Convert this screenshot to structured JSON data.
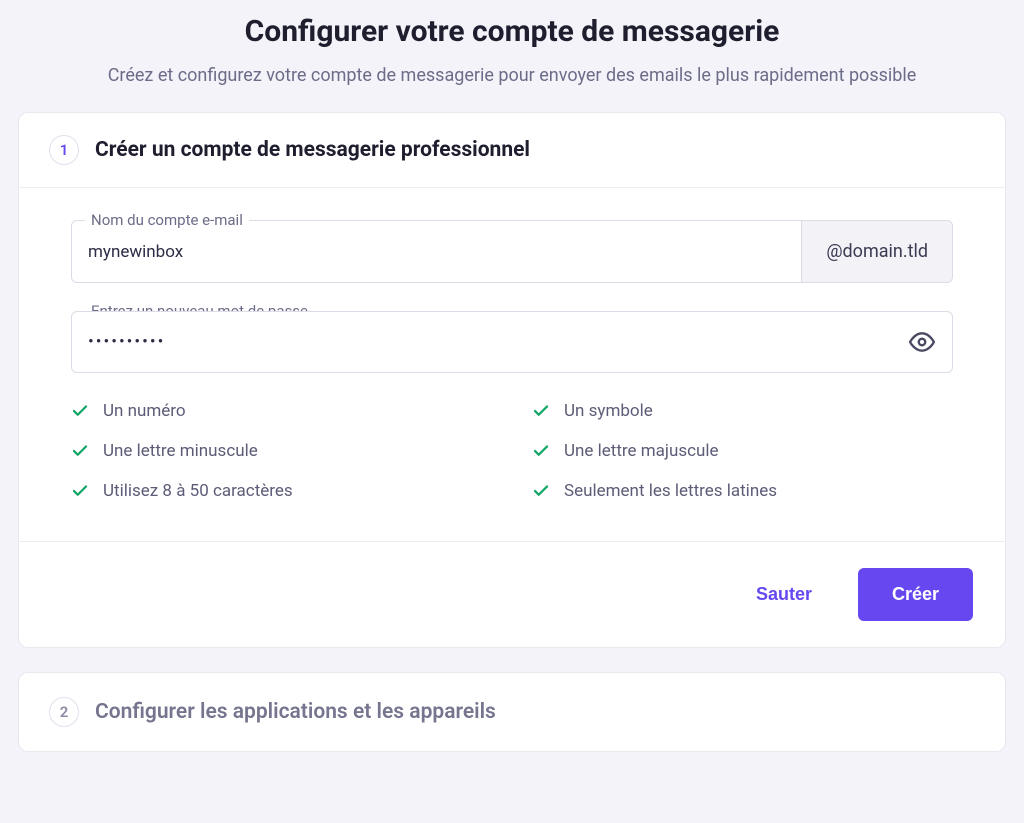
{
  "header": {
    "title": "Configurer votre compte de messagerie",
    "subtitle": "Créez et configurez votre compte de messagerie pour envoyer des emails le plus rapidement possible"
  },
  "step1": {
    "number": "1",
    "title": "Créer un compte de messagerie professionnel",
    "email_label": "Nom du compte e-mail",
    "email_value": "mynewinbox",
    "domain_suffix": "@domain.tld",
    "password_label": "Entrez un nouveau mot de passe",
    "password_value": "••••••••••",
    "requirements": {
      "r1": "Un numéro",
      "r2": "Un symbole",
      "r3": "Une lettre minuscule",
      "r4": "Une lettre majuscule",
      "r5": "Utilisez 8 à 50 caractères",
      "r6": "Seulement les lettres latines"
    },
    "skip_label": "Sauter",
    "create_label": "Créer"
  },
  "step2": {
    "number": "2",
    "title": "Configurer les applications et les appareils"
  }
}
